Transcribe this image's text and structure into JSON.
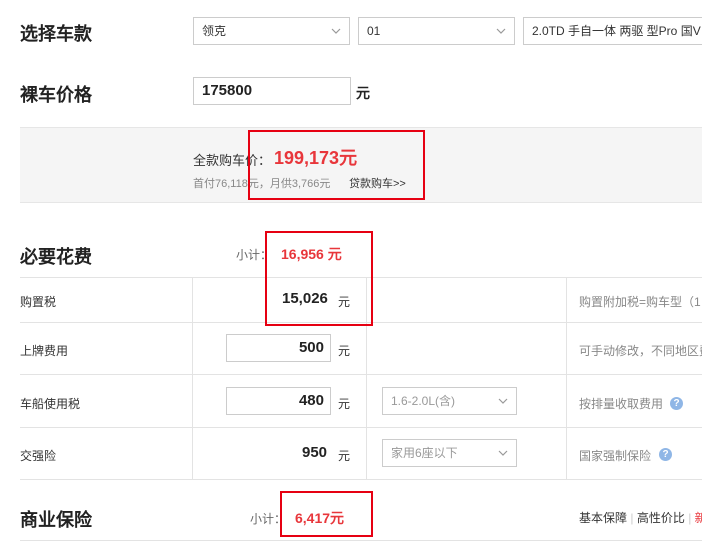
{
  "select_model": {
    "title": "选择车款",
    "brand": "领克",
    "series": "01",
    "trim": "2.0TD 手自一体 两驱 型Pro 国V"
  },
  "bare_price": {
    "title": "裸车价格",
    "value": "175800",
    "unit": "元"
  },
  "full_payment": {
    "label": "全款购车价：",
    "amount": "199,173元",
    "installment_text": "首付76,118元，月供3,766元",
    "loan_link": "贷款购车>>"
  },
  "required_fees": {
    "title": "必要花费",
    "subtotal_label": "小计：",
    "subtotal_value": "16,956 元",
    "rows": [
      {
        "label": "购置税",
        "value": "15,026",
        "unit": "元",
        "note": "购置附加税=购车型（1"
      },
      {
        "label": "上牌费用",
        "value": "500",
        "unit": "元",
        "note": "可手动修改，不同地区费"
      },
      {
        "label": "车船使用税",
        "value": "480",
        "unit": "元",
        "option": "1.6-2.0L(含)",
        "note": "按排量收取费用"
      },
      {
        "label": "交强险",
        "value": "950",
        "unit": "元",
        "option": "家用6座以下",
        "note": "国家强制保险"
      }
    ]
  },
  "commercial_insurance": {
    "title": "商业保险",
    "subtotal_label": "小计：",
    "subtotal_value": "6,417元",
    "links": [
      "基本保障",
      "高性价比",
      "新"
    ],
    "separator": "|"
  },
  "colors": {
    "accent_red": "#e8363b",
    "highlight_box": "#e60012",
    "help_icon": "#8fb6e6"
  }
}
